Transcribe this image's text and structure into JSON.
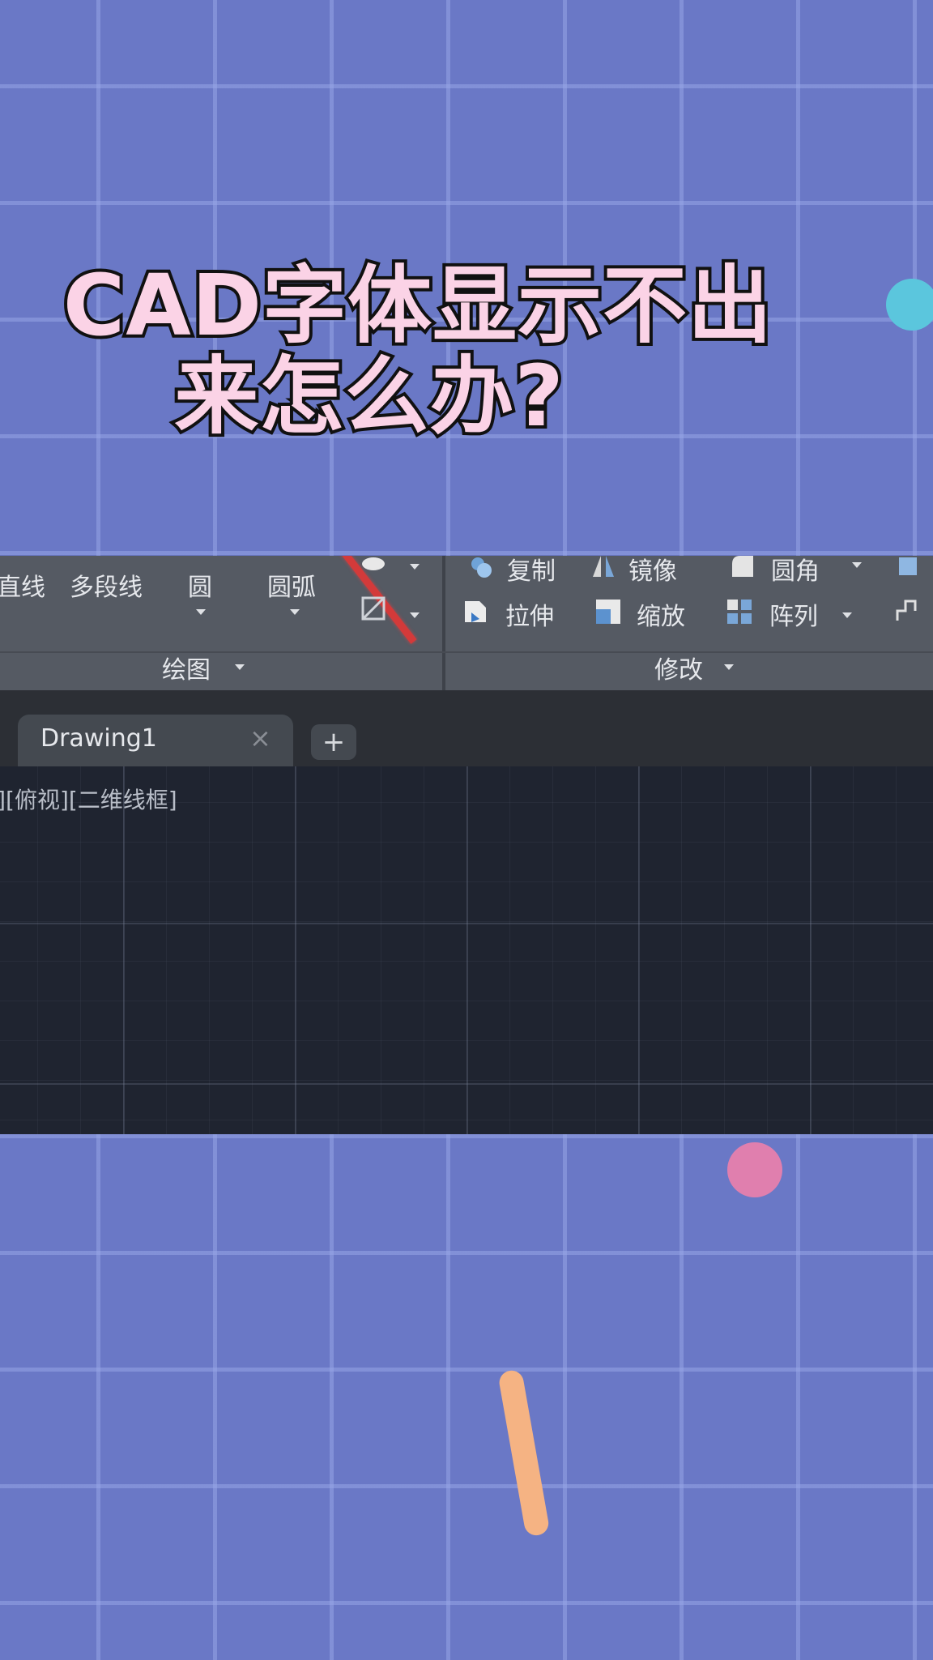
{
  "overlay": {
    "title_line1": "CAD字体显示不出",
    "title_line2": "来怎么办?",
    "title_color": "#fbd3e6",
    "background_color": "#6a78c6"
  },
  "ribbon": {
    "draw_tools": [
      "直线",
      "多段线",
      "圆",
      "圆弧"
    ],
    "draw_panel_label": "绘图",
    "modify_top_row": [
      "复制",
      "镜像",
      "圆角"
    ],
    "modify_tools": [
      "拉伸",
      "缩放",
      "阵列"
    ],
    "modify_panel_label": "修改"
  },
  "tabs": {
    "active_tab": "Drawing1",
    "close_glyph": "×",
    "add_glyph": "+"
  },
  "viewport": {
    "label": "-][俯视][二维线框]"
  },
  "icons": [
    "copy-icon",
    "mirror-icon",
    "fillet-icon",
    "stretch-icon",
    "scale-icon",
    "array-icon",
    "hatch-icon"
  ]
}
